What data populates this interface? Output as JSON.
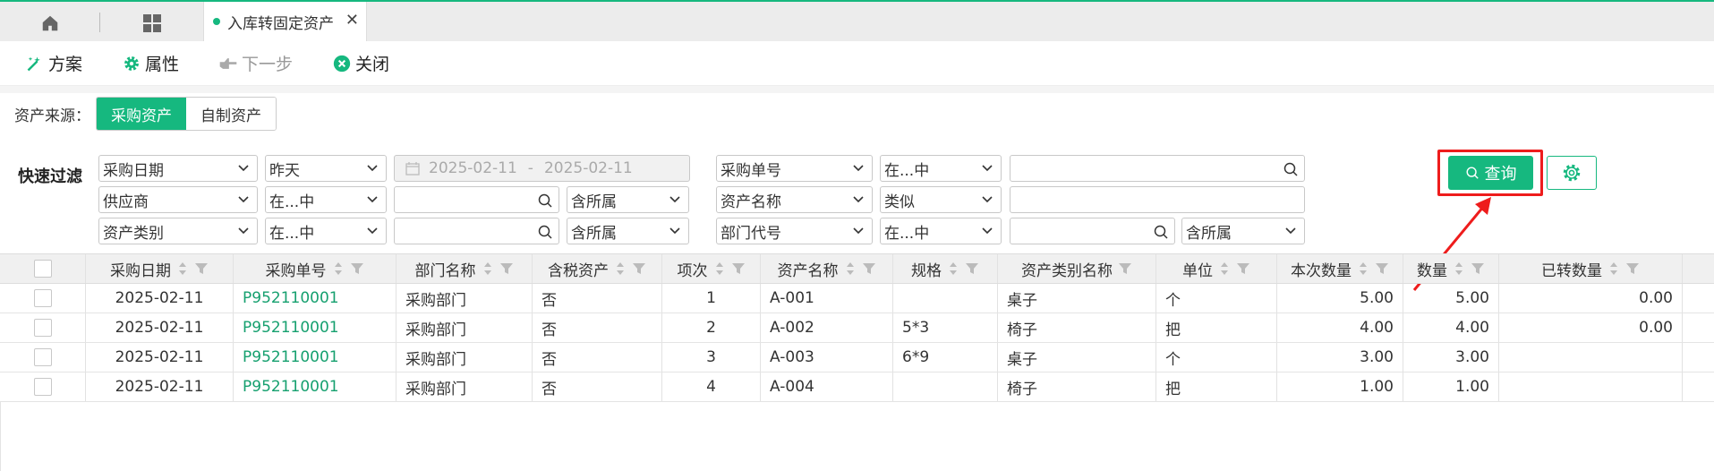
{
  "tabs": {
    "active_label": "入库转固定资产",
    "close_glyph": "✕"
  },
  "toolbar": {
    "plan": "方案",
    "properties": "属性",
    "next_step": "下一步",
    "close": "关闭"
  },
  "source": {
    "label": "资产来源：",
    "options": [
      "采购资产",
      "自制资产"
    ],
    "selected": "采购资产"
  },
  "filter": {
    "title": "快速过滤",
    "row1": {
      "field1": "采购日期",
      "op1": "昨天",
      "date_from": "2025-02-11",
      "date_sep": "-",
      "date_to": "2025-02-11",
      "field2": "采购单号",
      "op2": "在...中",
      "value2": ""
    },
    "row2": {
      "field1": "供应商",
      "op1": "在...中",
      "value1": "",
      "scope1": "含所属",
      "field2": "资产名称",
      "op2": "类似",
      "value2": ""
    },
    "row3": {
      "field1": "资产类别",
      "op1": "在...中",
      "value1": "",
      "scope1": "含所属",
      "field2": "部门代号",
      "op2": "在...中",
      "value2": "",
      "scope2": "含所属"
    },
    "query_button": "查询"
  },
  "table": {
    "columns": [
      "采购日期",
      "采购单号",
      "部门名称",
      "含税资产",
      "项次",
      "资产名称",
      "规格",
      "资产类别名称",
      "单位",
      "本次数量",
      "数量",
      "已转数量"
    ],
    "rows": [
      [
        "2025-02-11",
        "P952110001",
        "采购部门",
        "否",
        "1",
        "A-001",
        "",
        "桌子",
        "个",
        "5.00",
        "5.00",
        "0.00"
      ],
      [
        "2025-02-11",
        "P952110001",
        "采购部门",
        "否",
        "2",
        "A-002",
        "5*3",
        "椅子",
        "把",
        "4.00",
        "4.00",
        "0.00"
      ],
      [
        "2025-02-11",
        "P952110001",
        "采购部门",
        "否",
        "3",
        "A-003",
        "6*9",
        "桌子",
        "个",
        "3.00",
        "3.00",
        ""
      ],
      [
        "2025-02-11",
        "P952110001",
        "采购部门",
        "否",
        "4",
        "A-004",
        "",
        "椅子",
        "把",
        "1.00",
        "1.00",
        ""
      ]
    ]
  },
  "colors": {
    "accent": "#16b87f",
    "highlight": "#ee1c1c",
    "link": "#16a06f"
  }
}
